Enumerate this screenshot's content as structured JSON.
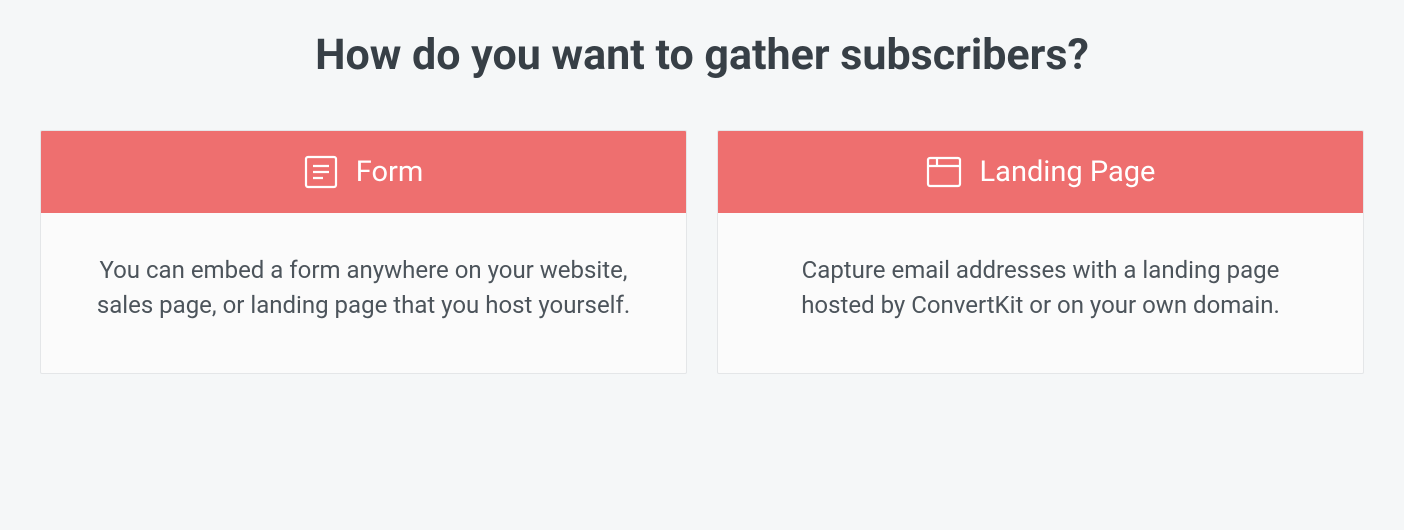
{
  "heading": "How do you want to gather subscribers?",
  "options": {
    "form": {
      "title": "Form",
      "description": "You can embed a form anywhere on your website, sales page, or landing page that you host yourself."
    },
    "landing_page": {
      "title": "Landing Page",
      "description": "Capture email addresses with a landing page hosted by ConvertKit or on your own domain."
    }
  },
  "colors": {
    "accent": "#ee6f6f",
    "heading": "#373f46",
    "body_text": "#4c545b",
    "page_bg": "#f5f7f8",
    "card_bg": "#fbfbfb",
    "card_border": "#e4e6e8"
  }
}
